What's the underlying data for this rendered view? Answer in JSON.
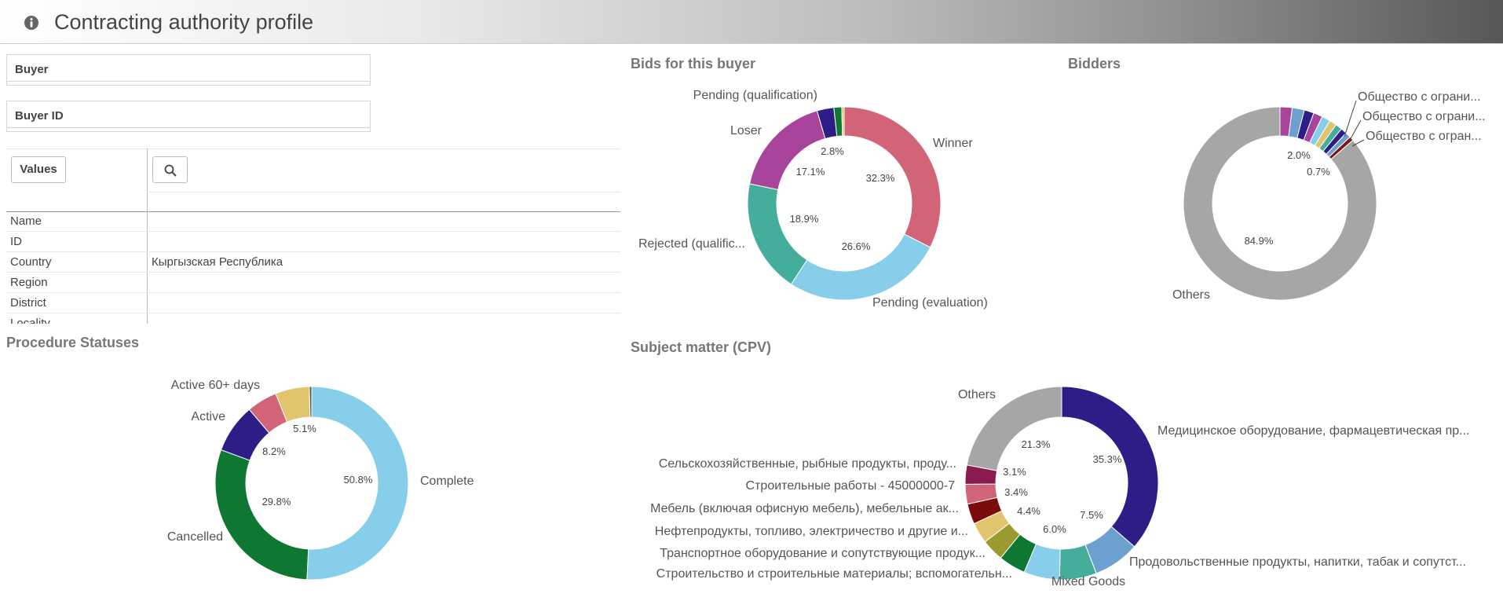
{
  "header": {
    "title": "Contracting authority profile",
    "info_icon": "info-icon"
  },
  "filters": {
    "buyer_label": "Buyer",
    "buyer_id_label": "Buyer ID"
  },
  "values_table": {
    "values_button": "Values",
    "search_icon": "search-icon",
    "rows": [
      {
        "key": "Name",
        "value": ""
      },
      {
        "key": "ID",
        "value": ""
      },
      {
        "key": "Country",
        "value": "Кыргызская Республика"
      },
      {
        "key": "Region",
        "value": ""
      },
      {
        "key": "District",
        "value": ""
      },
      {
        "key": "Locality",
        "value": ""
      }
    ]
  },
  "sections": {
    "bids": "Bids for this buyer",
    "bidders": "Bidders",
    "procedure": "Procedure Statuses",
    "cpv": "Subject matter (CPV)"
  },
  "colors": {
    "center": "#ffffff",
    "leader": "#444444"
  },
  "charts": {
    "bids": {
      "type": "pie",
      "slices": [
        {
          "name": "Winner",
          "value": 32.3,
          "pct": "32.3%",
          "color": "#d16577"
        },
        {
          "name": "Pending (evaluation)",
          "value": 26.6,
          "pct": "26.6%",
          "color": "#87ceeb"
        },
        {
          "name": "Rejected (qualific...",
          "value": 18.9,
          "pct": "18.9%",
          "color": "#44ad9c"
        },
        {
          "name": "Loser",
          "value": 17.1,
          "pct": "17.1%",
          "color": "#a9449d"
        },
        {
          "name": "Pending (qualification)",
          "value": 2.8,
          "pct": "2.8%",
          "color": "#2d1e87"
        },
        {
          "name": "",
          "value": 1.3,
          "pct": "",
          "color": "#0e7833"
        },
        {
          "name": "",
          "value": 0.4,
          "pct": "",
          "color": "#e0c56e"
        }
      ]
    },
    "bidders": {
      "type": "pie",
      "slices": [
        {
          "name": "",
          "value": 2.0,
          "pct": "2.0%",
          "color": "#a9449d"
        },
        {
          "name": "",
          "value": 2.0,
          "pct": "",
          "color": "#6ca0cf"
        },
        {
          "name": "",
          "value": 1.6,
          "pct": "",
          "color": "#2d1e87"
        },
        {
          "name": "",
          "value": 1.5,
          "pct": "",
          "color": "#a9449d"
        },
        {
          "name": "",
          "value": 1.4,
          "pct": "",
          "color": "#87ceeb"
        },
        {
          "name": "",
          "value": 1.2,
          "pct": "",
          "color": "#e0c56e"
        },
        {
          "name": "",
          "value": 1.1,
          "pct": "",
          "color": "#44ad9c"
        },
        {
          "name": "Общество с ограни...",
          "value": 1.0,
          "pct": "",
          "color": "#2d1e87"
        },
        {
          "name": "Общество с ограни...",
          "value": 0.9,
          "pct": "",
          "color": "#6ca0cf"
        },
        {
          "name": "Общество с огран...",
          "value": 0.7,
          "pct": "0.7%",
          "color": "#7a1515"
        },
        {
          "name": "Others",
          "value": 84.9,
          "pct": "84.9%",
          "color": "#a6a6a6"
        }
      ]
    },
    "procedure": {
      "type": "pie",
      "slices": [
        {
          "name": "Complete",
          "value": 50.8,
          "pct": "50.8%",
          "color": "#87ceeb"
        },
        {
          "name": "Cancelled",
          "value": 29.8,
          "pct": "29.8%",
          "color": "#0e7833"
        },
        {
          "name": "Active",
          "value": 8.2,
          "pct": "8.2%",
          "color": "#2d1e87"
        },
        {
          "name": "Active 60+ days",
          "value": 5.1,
          "pct": "5.1%",
          "color": "#d16577"
        },
        {
          "name": "",
          "value": 5.7,
          "pct": "",
          "color": "#e0c56e"
        },
        {
          "name": "",
          "value": 0.4,
          "pct": "",
          "color": "#555555"
        }
      ]
    },
    "cpv": {
      "type": "pie",
      "slices": [
        {
          "name": "Медицинское оборудование, фармацевтическая пр...",
          "value": 35.3,
          "pct": "35.3%",
          "color": "#2d1e87"
        },
        {
          "name": "Продовольственные продукты, напитки, табак и сопутст...",
          "value": 7.5,
          "pct": "7.5%",
          "color": "#6ca0cf"
        },
        {
          "name": "Mixed Goods",
          "value": 6.0,
          "pct": "6.0%",
          "color": "#44ad9c"
        },
        {
          "name": "",
          "value": 5.8,
          "pct": "",
          "color": "#87ceeb"
        },
        {
          "name": "Строительство и строительные материалы; вспомогательн...",
          "value": 4.4,
          "pct": "4.4%",
          "color": "#0e7833"
        },
        {
          "name": "Транспортное оборудование и сопутствующие продук...",
          "value": 3.6,
          "pct": "",
          "color": "#9b9a30"
        },
        {
          "name": "Нефтепродукты, топливо, электричество и другие и...",
          "value": 3.4,
          "pct": "3.4%",
          "color": "#e0c56e"
        },
        {
          "name": "Мебель (включая офисную мебель), мебельные ак...",
          "value": 3.3,
          "pct": "",
          "color": "#7a0c0c"
        },
        {
          "name": "Строительные работы - 45000000-7",
          "value": 3.2,
          "pct": "",
          "color": "#d16577"
        },
        {
          "name": "Сельскохозяйственные, рыбные продукты, проду...",
          "value": 3.1,
          "pct": "3.1%",
          "color": "#8b1a4f"
        },
        {
          "name": "Others",
          "value": 21.3,
          "pct": "21.3%",
          "color": "#a6a6a6"
        }
      ]
    }
  },
  "chart_data": [
    {
      "type": "pie",
      "title": "Bids for this buyer",
      "labels": [
        "Winner",
        "Pending (evaluation)",
        "Rejected (qualific...",
        "Loser",
        "Pending (qualification)",
        "",
        ""
      ],
      "values": [
        32.3,
        26.6,
        18.9,
        17.1,
        2.8,
        1.3,
        0.4
      ]
    },
    {
      "type": "pie",
      "title": "Bidders",
      "labels": [
        "",
        "",
        "",
        "",
        "",
        "",
        "",
        "Общество с ограни...",
        "Общество с ограни...",
        "Общество с огран...",
        "Others"
      ],
      "values": [
        2.0,
        2.0,
        1.6,
        1.5,
        1.4,
        1.2,
        1.1,
        1.0,
        0.9,
        0.7,
        84.9
      ]
    },
    {
      "type": "pie",
      "title": "Procedure Statuses",
      "labels": [
        "Complete",
        "Cancelled",
        "Active",
        "Active 60+ days",
        "",
        ""
      ],
      "values": [
        50.8,
        29.8,
        8.2,
        5.1,
        5.7,
        0.4
      ]
    },
    {
      "type": "pie",
      "title": "Subject matter (CPV)",
      "labels": [
        "Медицинское оборудование, фармацевтическая пр...",
        "Продовольственные продукты, напитки, табак и сопутст...",
        "Mixed Goods",
        "",
        "Строительство и строительные материалы; вспомогательн...",
        "Транспортное оборудование и сопутствующие продук...",
        "Нефтепродукты, топливо, электричество и другие и...",
        "Мебель (включая офисную мебель), мебельные ак...",
        "Строительные работы - 45000000-7",
        "Сельскохозяйственные, рыбные продукты, проду...",
        "Others"
      ],
      "values": [
        35.3,
        7.5,
        6.0,
        5.8,
        4.4,
        3.6,
        3.4,
        3.3,
        3.2,
        3.1,
        21.3
      ]
    }
  ]
}
